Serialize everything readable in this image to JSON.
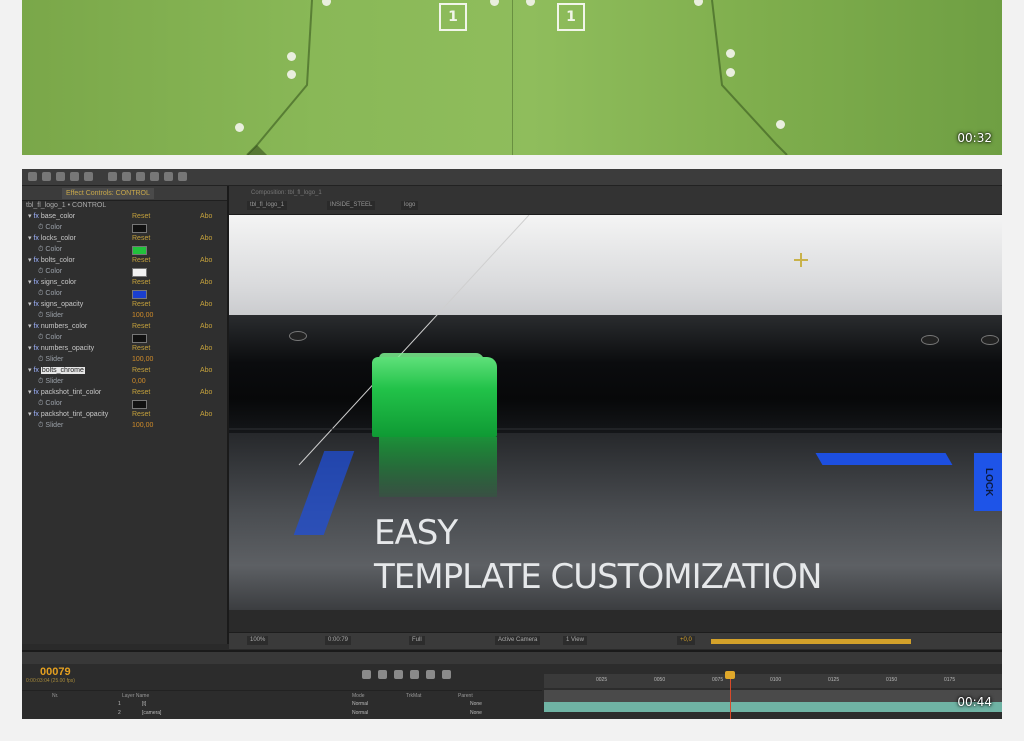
{
  "videos": [
    {
      "duration": "00:32",
      "panel_numbers": [
        "1",
        "1"
      ]
    },
    {
      "duration": "00:44",
      "headline": [
        "EASY",
        "TEMPLATE CUSTOMIZATION"
      ],
      "lock_label": "LOCK",
      "effects_panel": {
        "tab_label": "Effect Controls: CONTROL",
        "path": "tbl_fl_logo_1 • CONTROL",
        "reset_label": "Reset",
        "about_label": "Abo",
        "properties": [
          {
            "name": "base_color",
            "sub": "Color",
            "swatch": "#111111"
          },
          {
            "name": "locks_color",
            "sub": "Color",
            "swatch": "#22c23c"
          },
          {
            "name": "bolts_color",
            "sub": "Color",
            "swatch": "#f2f2f2"
          },
          {
            "name": "signs_color",
            "sub": "Color",
            "swatch": "#1a3fd0"
          },
          {
            "name": "signs_opacity",
            "sub": "Slider",
            "value": "100,00"
          },
          {
            "name": "numbers_color",
            "sub": "Color",
            "swatch": "#111111"
          },
          {
            "name": "numbers_opacity",
            "sub": "Slider",
            "value": "100,00"
          },
          {
            "name": "bolts_chrome",
            "sub": "Slider",
            "value": "0,00",
            "selected": true
          },
          {
            "name": "packshot_tint_color",
            "sub": "Color",
            "swatch": "#111111"
          },
          {
            "name": "packshot_tint_opacity",
            "sub": "Slider",
            "value": "100,00"
          }
        ]
      },
      "viewer": {
        "tab_label": "Composition: tbl_fl_logo_1",
        "crumbs": [
          "tbl_fl_logo_1",
          "INSIDE_STEEL",
          "logo"
        ],
        "zoom": "100%",
        "timecode": "0:00:79",
        "resolution": "Full",
        "camera": "Active Camera",
        "views": "1 View",
        "offset": "+0,0"
      },
      "timeline": {
        "time": "00079",
        "fps": "0:00:03:04 (25.00 fps)",
        "columns": [
          "Nr.",
          "Layer Name",
          "Mode",
          "TrkMat",
          "Parent"
        ],
        "layers": [
          {
            "num": "1",
            "name": "[t]",
            "mode": "Normal",
            "parent": "None"
          },
          {
            "num": "2",
            "name": "[camera]",
            "mode": "Normal",
            "parent": "None"
          }
        ],
        "ruler_marks": [
          "0025",
          "0050",
          "0075",
          "0100",
          "0125",
          "0150",
          "0175"
        ]
      }
    }
  ]
}
